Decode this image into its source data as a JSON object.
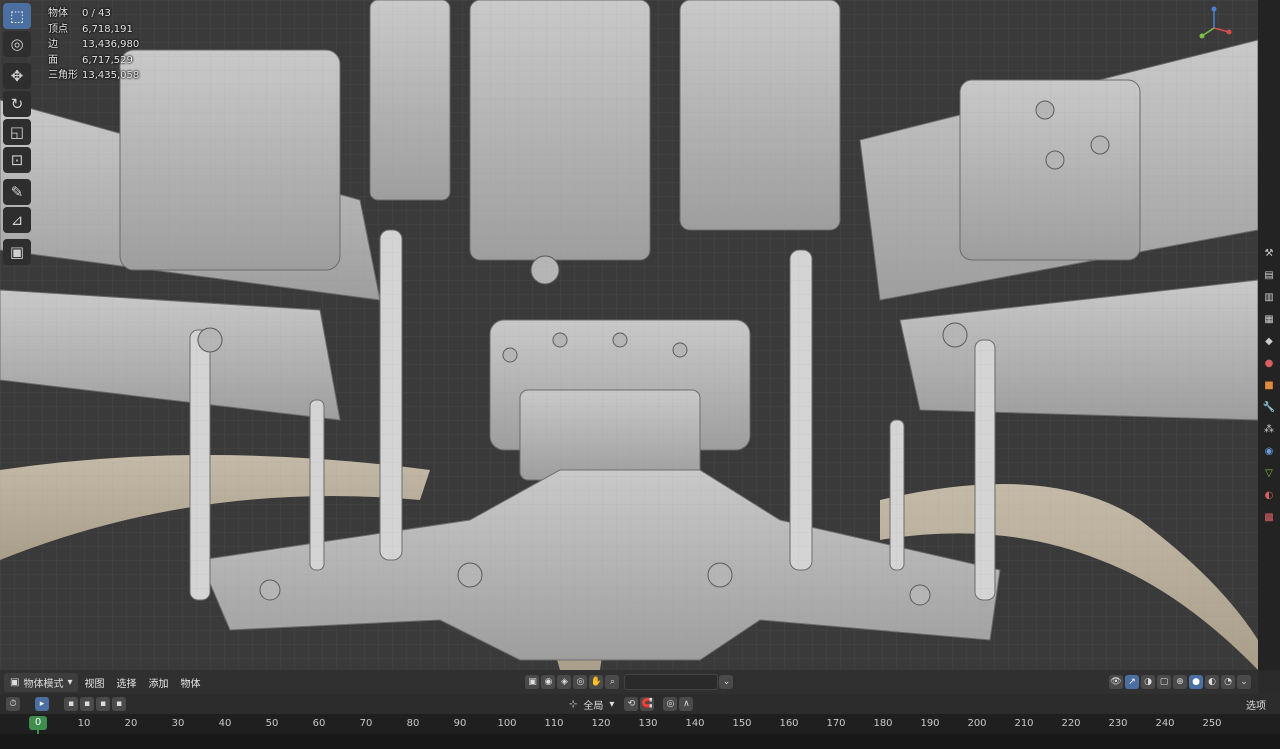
{
  "stats": [
    {
      "label": "物体",
      "value": "0 / 43"
    },
    {
      "label": "顶点",
      "value": "6,718,191"
    },
    {
      "label": "边",
      "value": "13,436,980"
    },
    {
      "label": "面",
      "value": "6,717,529"
    },
    {
      "label": "三角形",
      "value": "13,435,058"
    }
  ],
  "header": {
    "mode": "物体模式",
    "menu": [
      "视图",
      "选择",
      "添加",
      "物体"
    ]
  },
  "timeline": {
    "transform": "全局",
    "options": "选项",
    "current_frame": "0",
    "ticks": [
      "10",
      "20",
      "30",
      "40",
      "50",
      "60",
      "70",
      "80",
      "90",
      "100",
      "110",
      "120",
      "130",
      "140",
      "150",
      "160",
      "170",
      "180",
      "190",
      "200",
      "210",
      "220",
      "230",
      "240",
      "250"
    ]
  },
  "colors": {
    "accent": "#4b6fa1",
    "frame": "#3f8e4f",
    "viewport": "#3a3a3a"
  }
}
